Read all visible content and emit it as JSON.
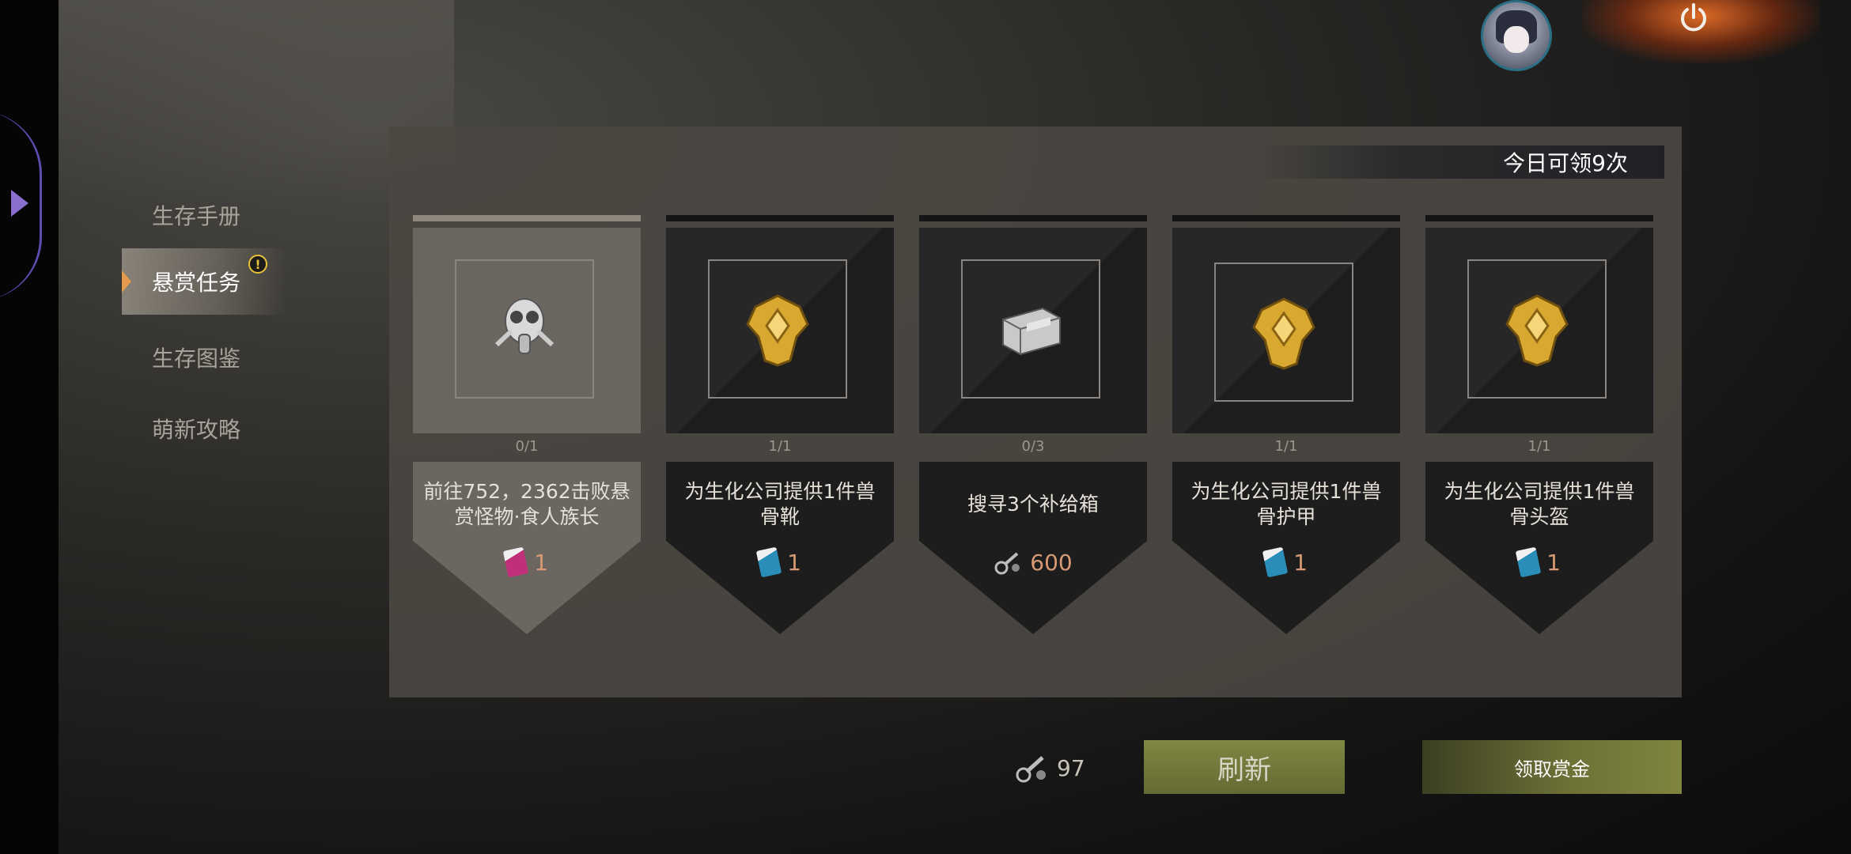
{
  "top": {
    "power_icon": "power-icon",
    "avatar_icon": "character-avatar"
  },
  "menu": {
    "items": [
      {
        "label": "生存手册"
      },
      {
        "label": "悬赏任务",
        "alert": "!"
      },
      {
        "label": "生存图鉴"
      },
      {
        "label": "萌新攻略"
      }
    ]
  },
  "panel": {
    "daily_count": "今日可领9次",
    "cards": [
      {
        "progress": "0/1",
        "desc": "前往752，2362击败悬赏怪物·食人族长",
        "reward_icon": "pink-ticket-icon",
        "reward_amount": "1",
        "image_icon": "gas-mask-icon",
        "selected": true
      },
      {
        "progress": "1/1",
        "desc": "为生化公司提供1件兽骨靴",
        "reward_icon": "blue-ticket-icon",
        "reward_amount": "1",
        "image_icon": "gold-armor-icon"
      },
      {
        "progress": "0/3",
        "desc": "搜寻3个补给箱",
        "reward_icon": "parts-icon",
        "reward_amount": "600",
        "image_icon": "supply-crate-icon"
      },
      {
        "progress": "1/1",
        "desc": "为生化公司提供1件兽骨护甲",
        "reward_icon": "blue-ticket-icon",
        "reward_amount": "1",
        "image_icon": "gold-armor-icon"
      },
      {
        "progress": "1/1",
        "desc": "为生化公司提供1件兽骨头盔",
        "reward_icon": "blue-ticket-icon",
        "reward_amount": "1",
        "image_icon": "gold-armor-icon"
      }
    ]
  },
  "bottom": {
    "currency_amount": "97",
    "refresh_label": "刷新",
    "claim_label": "领取赏金"
  },
  "colors": {
    "accent_orange": "#e59a4e",
    "reward_amount": "#d79a74",
    "refresh_button": "#7f8743",
    "alert_yellow": "#e8c23a"
  }
}
